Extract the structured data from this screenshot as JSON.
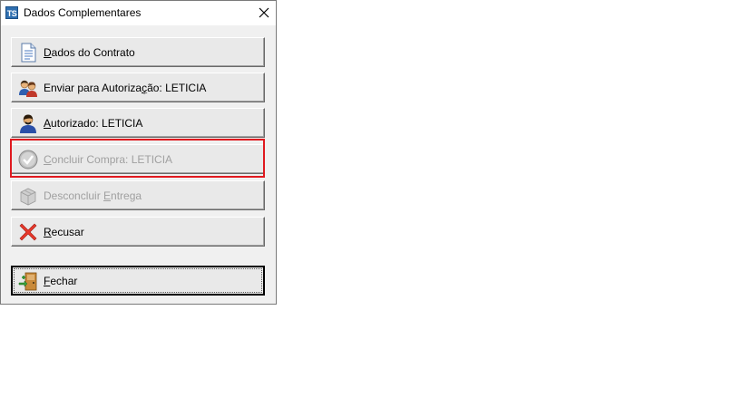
{
  "window": {
    "title": "Dados Complementares",
    "app_icon_text": "TS"
  },
  "buttons": {
    "dados_contrato": {
      "pre": "",
      "ul": "D",
      "post": "ados do Contrato"
    },
    "enviar_autorizacao": {
      "pre": "Enviar para Autoriza",
      "ul": "ç",
      "post": "ão: LETICIA"
    },
    "autorizado": {
      "pre": "",
      "ul": "A",
      "post": "utorizado: LETICIA"
    },
    "concluir_compra": {
      "pre": "",
      "ul": "C",
      "post": "oncluir Compra: LETICIA"
    },
    "desconcluir_entrega": {
      "pre": "Desconcluir ",
      "ul": "E",
      "post": "ntrega"
    },
    "recusar": {
      "pre": "",
      "ul": "R",
      "post": "ecusar"
    },
    "fechar": {
      "pre": "",
      "ul": "F",
      "post": "echar"
    }
  }
}
